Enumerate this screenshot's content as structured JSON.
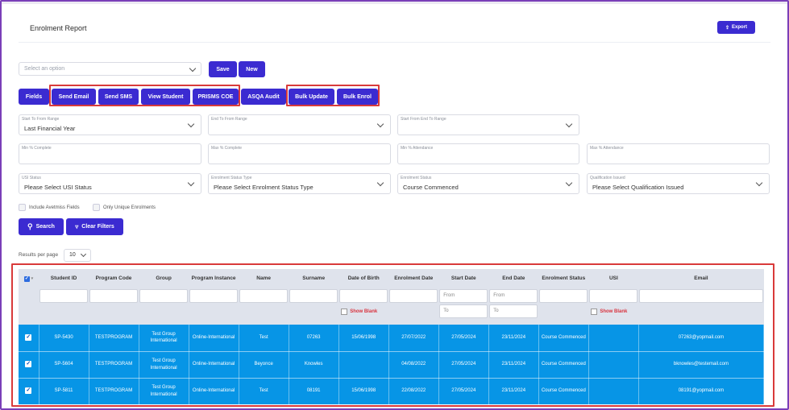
{
  "header": {
    "title": "Enrolment Report",
    "export_label": "Export"
  },
  "toolbar": {
    "select_placeholder": "Select an option",
    "save_label": "Save",
    "new_label": "New"
  },
  "actions": {
    "fields": "Fields",
    "send_email": "Send Email",
    "send_sms": "Send SMS",
    "view_student": "View Student",
    "prisms_coe": "PRISMS COE",
    "asqa_audit": "ASQA Audit",
    "bulk_update": "Bulk Update",
    "bulk_enrol": "Bulk Enrol"
  },
  "filters": {
    "start_to_from_range": {
      "label": "Start To From Range",
      "value": "Last Financial Year"
    },
    "end_to_from_range": {
      "label": "End To From Range",
      "value": ""
    },
    "start_from_end_to_range": {
      "label": "Start From End To Range",
      "value": ""
    },
    "min_complete": {
      "label": "Min % Complete",
      "value": ""
    },
    "max_complete": {
      "label": "Max % Complete",
      "value": ""
    },
    "min_attendance": {
      "label": "Min % Attendance",
      "value": ""
    },
    "max_attendance": {
      "label": "Max % Attendance",
      "value": ""
    },
    "usi_status": {
      "label": "USI Status",
      "value": "Please Select USI Status"
    },
    "enrolment_status_type": {
      "label": "Enrolment Status Type",
      "value": "Please Select Enrolment Status Type"
    },
    "enrolment_status": {
      "label": "Enrolment Status",
      "value": "Course Commenced"
    },
    "qualification_issued": {
      "label": "Qualification Issued",
      "value": "Please Select Qualification Issued"
    },
    "include_avetmiss": "Include Avetmiss Fields",
    "only_unique": "Only Unique Enrolments",
    "search_label": "Search",
    "clear_label": "Clear Filters"
  },
  "pagination": {
    "label": "Results per page",
    "value": "10"
  },
  "table": {
    "columns": [
      "Student ID",
      "Program Code",
      "Group",
      "Program Instance",
      "Name",
      "Surname",
      "Date of Birth",
      "Enrolment Date",
      "Start Date",
      "End Date",
      "Enrolment Status",
      "USI",
      "Email"
    ],
    "filter_from": "From",
    "filter_to": "To",
    "show_blank": "Show Blank",
    "rows": [
      {
        "id": "SP-5430",
        "code": "TESTPROGRAM",
        "group": "Test Group International",
        "instance": "Online-International",
        "name": "Test",
        "surname": "07263",
        "dob": "15/06/1998",
        "enrol": "27/07/2022",
        "start": "27/05/2024",
        "end": "23/11/2024",
        "status": "Course Commenced",
        "usi": "",
        "email": "07263@yopmail.com"
      },
      {
        "id": "SP-5604",
        "code": "TESTPROGRAM",
        "group": "Test Group International",
        "instance": "Online-International",
        "name": "Beyonce",
        "surname": "Knowles",
        "dob": "",
        "enrol": "04/08/2022",
        "start": "27/05/2024",
        "end": "23/11/2024",
        "status": "Course Commenced",
        "usi": "",
        "email": "bknowles@testemail.com"
      },
      {
        "id": "SP-5811",
        "code": "TESTPROGRAM",
        "group": "Test Group International",
        "instance": "Online-International",
        "name": "Test",
        "surname": "08191",
        "dob": "15/06/1998",
        "enrol": "22/08/2022",
        "start": "27/05/2024",
        "end": "23/11/2024",
        "status": "Course Commenced",
        "usi": "",
        "email": "08191@yopmail.com"
      }
    ]
  },
  "colors": {
    "primary": "#3b2bd1",
    "row_selected": "#0795e6",
    "highlight": "#d93a3a",
    "frame": "#7a3fb8"
  }
}
